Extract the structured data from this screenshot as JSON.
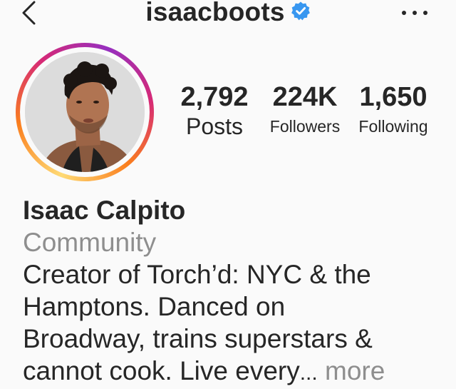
{
  "header": {
    "username": "isaacboots",
    "verified": true,
    "icons": {
      "back": "chevron-left-icon",
      "verified": "verified-badge-icon",
      "options": "more-horizontal-icon"
    }
  },
  "profile": {
    "avatar": {
      "icon": "profile-photo",
      "story_ring": true
    },
    "stats": [
      {
        "value": "2,792",
        "label": "Posts"
      },
      {
        "value": "224K",
        "label": "Followers"
      },
      {
        "value": "1,650",
        "label": "Following"
      }
    ],
    "full_name": "Isaac Calpito",
    "category": "Community",
    "bio_lines": [
      "Creator of Torch’d: NYC & the",
      "Hamptons. Danced on",
      "Broadway, trains superstars &",
      "cannot cook. Live every"
    ],
    "bio_ellipsis": "...",
    "more_label": "more"
  },
  "colors": {
    "text": "#262626",
    "secondary": "#8e8e8e",
    "verified_blue": "#3897f0",
    "background": "#fafafa"
  }
}
